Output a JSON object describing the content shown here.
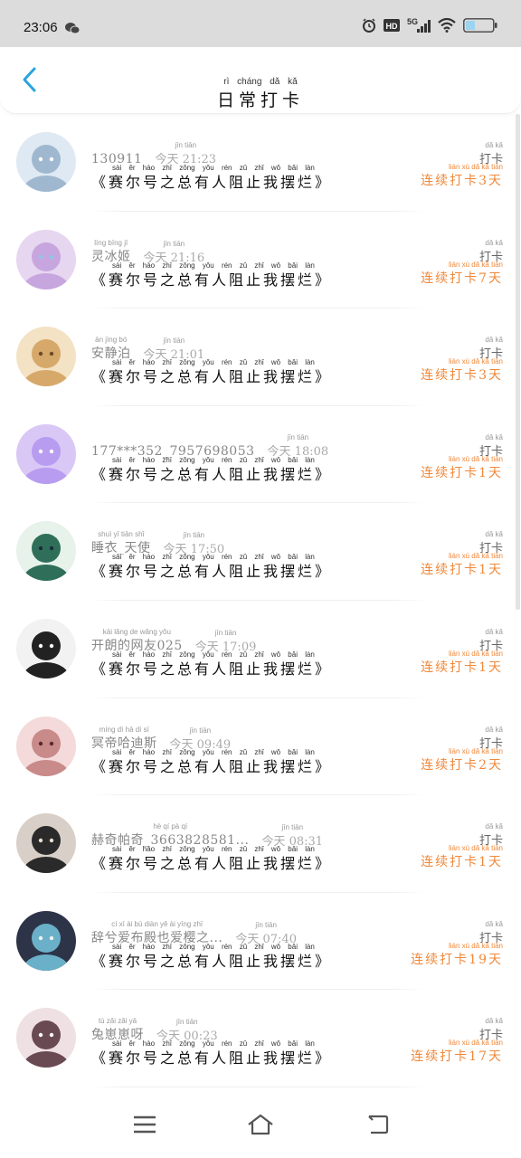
{
  "status_bar": {
    "time": "23:06",
    "icons": [
      "wechat-icon",
      "alarm-icon",
      "hd-icon",
      "5g-signal-icon",
      "wifi-icon",
      "battery-icon"
    ],
    "hd_label": "HD",
    "network_label": "5G"
  },
  "header": {
    "title": "日常打卡",
    "title_pinyin": "rì cháng dǎ kǎ",
    "back_icon": "chevron-left-icon",
    "accent_color": "#2aa4dc"
  },
  "list_labels": {
    "clockin": "打卡",
    "clockin_pinyin": "dǎ kǎ",
    "plan": "《赛尔号之总有人阻止我摆烂》",
    "plan_pinyin": "sài ěr hào zhī zǒng yǒu rén zǔ zhǐ wǒ bǎi làn",
    "today": "今天",
    "today_pinyin": "jīn tiān",
    "streak_pinyin": "lián xù dǎ kǎ tiān"
  },
  "entries": [
    {
      "name": "130911",
      "name_pinyin": "",
      "time": "21:23",
      "streak_text": "连续打卡3天"
    },
    {
      "name": "灵冰姬",
      "name_pinyin": "líng bīng jī",
      "time": "21:16",
      "streak_text": "连续打卡7天"
    },
    {
      "name": "安静泊",
      "name_pinyin": "ān jìng bó",
      "time": "21:01",
      "streak_text": "连续打卡3天"
    },
    {
      "name": "177***352_7957698053",
      "name_pinyin": "",
      "time": "18:08",
      "streak_text": "连续打卡1天"
    },
    {
      "name": "睡衣_天使",
      "name_pinyin": "shuì yī tiān shǐ",
      "time": "17:50",
      "streak_text": "连续打卡1天"
    },
    {
      "name": "开朗的网友025",
      "name_pinyin": "kāi lǎng de wǎng yǒu",
      "time": "17:09",
      "streak_text": "连续打卡1天"
    },
    {
      "name": "冥帝哈迪斯",
      "name_pinyin": "míng dì hā dí sī",
      "time": "09:49",
      "streak_text": "连续打卡2天"
    },
    {
      "name": "赫奇帕奇_3663828581...",
      "name_pinyin": "hè qí pà qí",
      "time": "08:31",
      "streak_text": "连续打卡1天"
    },
    {
      "name": "辞兮爱布殿也爱樱之...",
      "name_pinyin": "cí xī ài bù diàn yě ài yīng zhī",
      "time": "07:40",
      "streak_text": "连续打卡19天"
    },
    {
      "name": "兔崽崽呀",
      "name_pinyin": "tù zǎi zǎi yā",
      "time": "00:23",
      "streak_text": "连续打卡17天"
    }
  ],
  "colors": {
    "streak": "#f0883a",
    "status_bg": "#dcdcdc",
    "back_arrow": "#2aa4dc"
  },
  "navbar": {
    "icons": [
      "menu-icon",
      "home-icon",
      "back-icon"
    ]
  }
}
